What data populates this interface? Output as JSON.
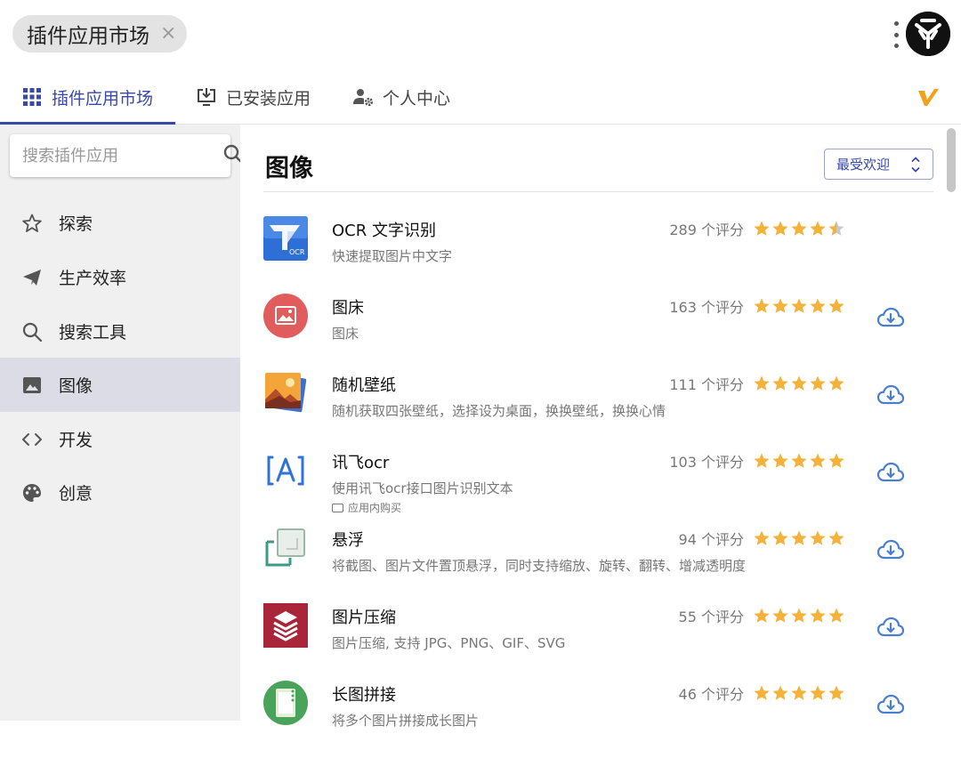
{
  "window": {
    "title": "插件应用市场",
    "close_symbol": "×"
  },
  "tabs": [
    {
      "label": "插件应用市场",
      "icon": "grid-icon",
      "active": true
    },
    {
      "label": "已安装应用",
      "icon": "installed-download-icon",
      "active": false
    },
    {
      "label": "个人中心",
      "icon": "user-settings-icon",
      "active": false
    }
  ],
  "search": {
    "placeholder": "搜索插件应用",
    "value": ""
  },
  "sidebar": {
    "items": [
      {
        "label": "探索",
        "icon": "star-outline-icon"
      },
      {
        "label": "生产效率",
        "icon": "send-icon"
      },
      {
        "label": "搜索工具",
        "icon": "search-icon"
      },
      {
        "label": "图像",
        "icon": "image-icon",
        "active": true
      },
      {
        "label": "开发",
        "icon": "code-icon"
      },
      {
        "label": "创意",
        "icon": "palette-icon"
      }
    ]
  },
  "main": {
    "category_title": "图像",
    "sort_label": "最受欢迎",
    "apps": [
      {
        "name": "OCR 文字识别",
        "desc": "快速提取图片中文字",
        "rating_text": "289 个评分",
        "stars": 4.5,
        "installed": true,
        "icon": "ocr-icon"
      },
      {
        "name": "图床",
        "desc": "图床",
        "rating_text": "163 个评分",
        "stars": 5,
        "installed": false,
        "icon": "image-host-icon"
      },
      {
        "name": "随机壁纸",
        "desc": "随机获取四张壁纸，选择设为桌面，换换壁纸，换换心情",
        "rating_text": "111 个评分",
        "stars": 5,
        "installed": false,
        "icon": "wallpaper-icon"
      },
      {
        "name": "讯飞ocr",
        "desc": "使用讯飞ocr接口图片识别文本",
        "badge": "应用内购买",
        "rating_text": "103 个评分",
        "stars": 5,
        "installed": false,
        "icon": "xunfei-ocr-icon"
      },
      {
        "name": "悬浮",
        "desc": "将截图、图片文件置顶悬浮，同时支持缩放、旋转、翻转、增减透明度",
        "rating_text": "94 个评分",
        "stars": 5,
        "installed": false,
        "icon": "float-icon"
      },
      {
        "name": "图片压缩",
        "desc": "图片压缩, 支持 JPG、PNG、GIF、SVG",
        "rating_text": "55 个评分",
        "stars": 5,
        "installed": false,
        "icon": "compress-icon"
      },
      {
        "name": "长图拼接",
        "desc": "将多个图片拼接成长图片",
        "rating_text": "46 个评分",
        "stars": 5,
        "installed": false,
        "icon": "stitch-icon"
      }
    ]
  },
  "colors": {
    "accent": "#3949ab",
    "star": "#f4b23b",
    "download": "#4a7fd0",
    "sidebar_bg": "#f0f0f0",
    "active_bg": "#dcdce6"
  }
}
